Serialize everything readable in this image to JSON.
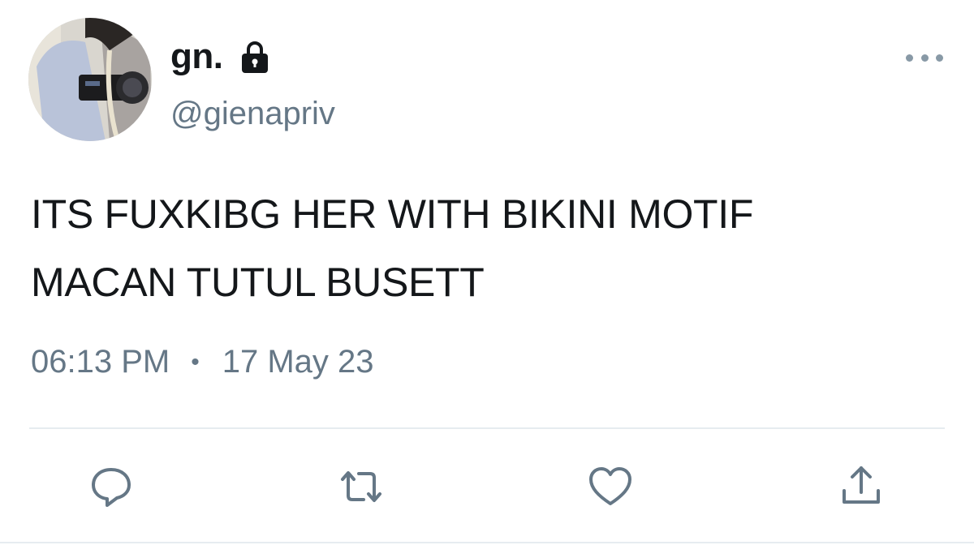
{
  "user": {
    "display_name": "gn.",
    "handle": "@gienapriv",
    "protected_icon": "lock-icon"
  },
  "tweet": {
    "text_line1": "ITS FUXKIBG HER WITH BIKINI MOTIF",
    "text_line2": "MACAN TUTUL BUSETT",
    "time": "06:13 PM",
    "separator": "•",
    "date": "17 May 23"
  },
  "actions": [
    {
      "icon": "reply-icon"
    },
    {
      "icon": "retweet-icon"
    },
    {
      "icon": "like-icon"
    },
    {
      "icon": "share-icon"
    }
  ],
  "colors": {
    "text": "#14171a",
    "secondary": "#657786",
    "icon": "#657786",
    "divider": "#e6ecf0"
  }
}
